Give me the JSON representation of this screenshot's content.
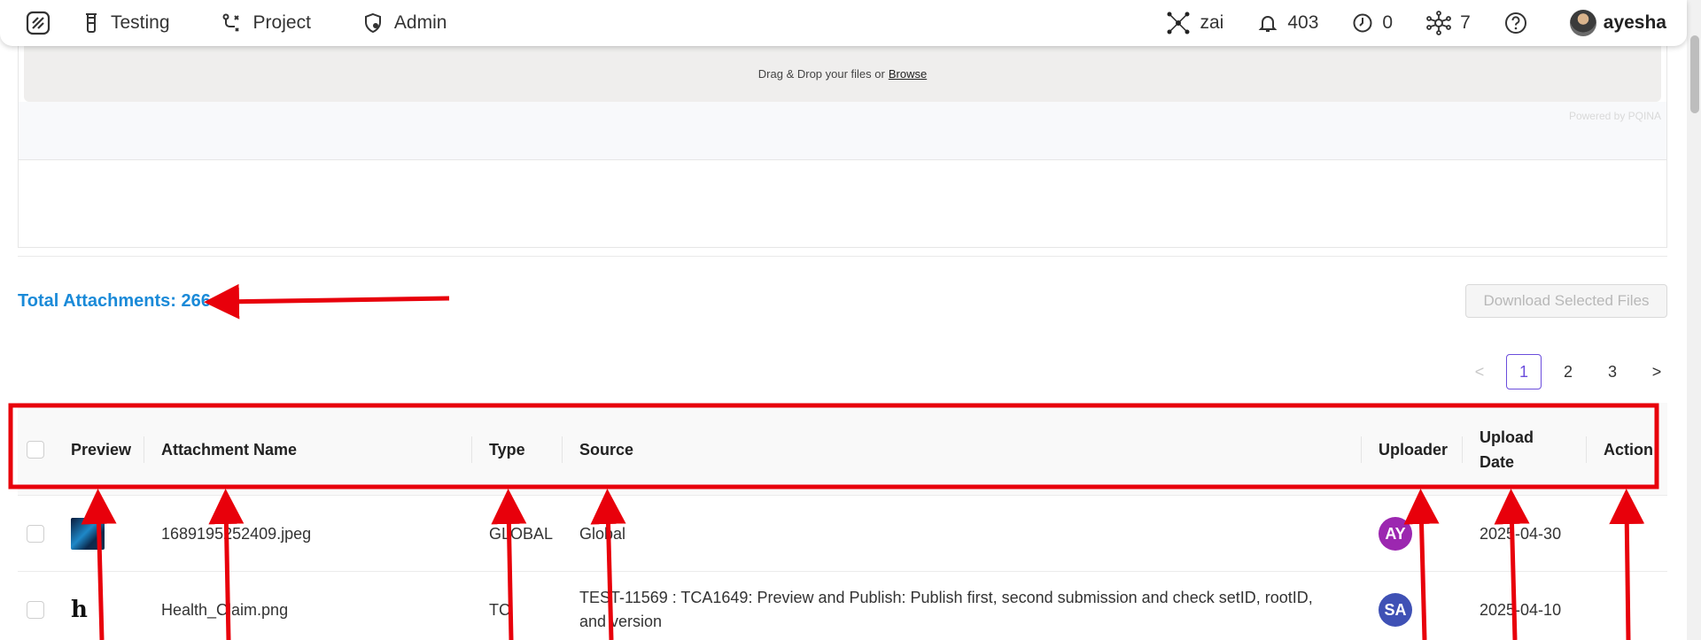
{
  "nav": {
    "items": [
      {
        "label": "Testing",
        "icon": "flask-icon"
      },
      {
        "label": "Project",
        "icon": "workflow-icon"
      },
      {
        "label": "Admin",
        "icon": "shield-gear-icon"
      }
    ],
    "right": {
      "ai_label": "zai",
      "notifications": "403",
      "history_count": "0",
      "integrations_count": "7",
      "user": "ayesha"
    }
  },
  "upload": {
    "drop_text": "Drag & Drop your files or",
    "browse": "Browse",
    "powered": "Powered by PQINA"
  },
  "total_attachments": "Total Attachments: 266",
  "download_button": "Download Selected Files",
  "pagination": {
    "prev": "<",
    "pages": [
      "1",
      "2",
      "3"
    ],
    "active": "1",
    "next": ">"
  },
  "table": {
    "headers": {
      "preview": "Preview",
      "name": "Attachment Name",
      "type": "Type",
      "source": "Source",
      "uploader": "Uploader",
      "upload_date_1": "Upload",
      "upload_date_2": "Date",
      "action": "Action"
    },
    "rows": [
      {
        "name": "1689195252409.jpeg",
        "type": "GLOBAL",
        "source": "Global",
        "uploader": "AY",
        "uploader_color": "#9c27b0",
        "date": "2025-04-30"
      },
      {
        "name": "Health_Claim.png",
        "type": "TC",
        "source": "TEST-11569 : TCA1649: Preview and Publish: Publish first, second submission and check setID, rootID, and version",
        "uploader": "SA",
        "uploader_color": "#3f51b5",
        "date": "2025-04-10",
        "preview_glyph": "h"
      }
    ]
  }
}
